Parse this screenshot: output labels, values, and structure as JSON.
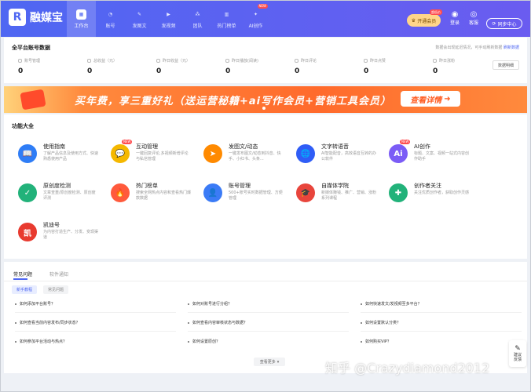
{
  "app": {
    "logo_mark": "R",
    "logo_text": "融媒宝"
  },
  "nav": [
    {
      "label": "工作台",
      "icon": "workbench-icon",
      "active": true
    },
    {
      "label": "账号",
      "icon": "account-icon"
    },
    {
      "label": "发图文",
      "icon": "pen-icon"
    },
    {
      "label": "发视频",
      "icon": "video-icon"
    },
    {
      "label": "团队",
      "icon": "team-icon"
    },
    {
      "label": "热门榜单",
      "icon": "chart-icon"
    },
    {
      "label": "AI创作",
      "icon": "ai-icon",
      "badge": "NEW"
    }
  ],
  "header": {
    "vip_label": "开通会员",
    "vip_tag": "超低价",
    "login_label": "登录",
    "help_label": "客服",
    "sync_label": "同步中心"
  },
  "stats": {
    "title": "全平台账号数据",
    "note": "数据会出现延迟情况，可手动刷新数据",
    "refresh_label": "刷新数据",
    "detail_label": "数据明细",
    "items": [
      {
        "label": "账号管理",
        "value": "0"
      },
      {
        "label": "总收益（元）",
        "value": "0"
      },
      {
        "label": "昨日收益（元）",
        "value": "0"
      },
      {
        "label": "昨日播放(阅读)",
        "value": "0"
      },
      {
        "label": "昨日评论",
        "value": "0"
      },
      {
        "label": "昨日点赞",
        "value": "0"
      },
      {
        "label": "昨日涨粉",
        "value": "0"
      }
    ]
  },
  "banner": {
    "text": "买年费，享三重好礼（送运营秘籍+ai写作会员+营销工具会员）",
    "button": "查看详情"
  },
  "features": {
    "title": "功能大全",
    "items": [
      {
        "name": "使用指南",
        "desc": "了解产品信息及使用方式、快速熟悉使用产品",
        "color": "#2f7df6",
        "glyph": "📖"
      },
      {
        "name": "互动管理",
        "desc": "一键回复评论,多视频新增评论与私信管理",
        "color": "#f5b800",
        "glyph": "💬",
        "badge": "NEW"
      },
      {
        "name": "发图文/动态",
        "desc": "一键发布图文/动态到抖音、快手、小红书、头条...",
        "color": "#ff8a00",
        "glyph": "➤"
      },
      {
        "name": "文字转语音",
        "desc": "AI智能配音，高效语音互转的办公软件",
        "color": "#2f5df6",
        "glyph": "🌐"
      },
      {
        "name": "AI创作",
        "desc": "标题、文案、视频一站式内容创作助手",
        "color": "#7b5cf6",
        "glyph": "Ai",
        "badge": "NEW"
      },
      {
        "name": "原创度检测",
        "desc": "文章查重/原创度检测、原创度评测",
        "color": "#22b27a",
        "glyph": "✓"
      },
      {
        "name": "热门榜单",
        "desc": "搜索全网热点内容和查看热门爆款数据",
        "color": "#ff5a3c",
        "glyph": "🔥"
      },
      {
        "name": "账号管理",
        "desc": "500+账号实时数据管理、方便管理",
        "color": "#3b7bf6",
        "glyph": "👤"
      },
      {
        "name": "自媒体学院",
        "desc": "新媒体赚钱、推广、营销、涨粉系列课程",
        "color": "#e8453c",
        "glyph": "🎓"
      },
      {
        "name": "创作者关注",
        "desc": "关注优质创作者，获取创作灵感",
        "color": "#22b27a",
        "glyph": "✚"
      },
      {
        "name": "凯迪号",
        "desc": "为内容打造生产、分发、变现渠道",
        "color": "#e83a2f",
        "glyph": "凯"
      }
    ]
  },
  "faq": {
    "tabs": [
      "常见问题",
      "软件通知"
    ],
    "chips": [
      "新手教程",
      "常见问题"
    ],
    "questions": [
      "如何添加平台账号？",
      "如何对账号进行分组？",
      "如何快速发文/发视频至多平台？",
      "如何查看当前内容发布/同步状态？",
      "如何查看内容审核状态与数据？",
      "如何设置默认分类？",
      "如何参加平台活动与热点？",
      "如何设置原创？",
      "如何购买VIP？"
    ],
    "more_label": "查看更多"
  },
  "side": {
    "label": "建议反馈"
  },
  "watermark": "知乎 @Crazydiamond2012"
}
